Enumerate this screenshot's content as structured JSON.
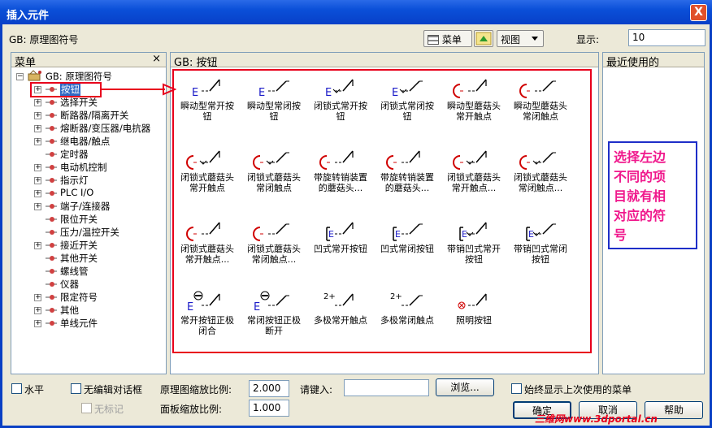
{
  "window": {
    "title": "插入元件",
    "close_label": "X"
  },
  "toolbar": {
    "standard_label": "GB: 原理图符号",
    "menu_btn": "菜单",
    "view_btn": "视图",
    "display_label": "显示:",
    "display_value": "10"
  },
  "tree": {
    "header": "菜单",
    "close": "×",
    "root": "GB: 原理图符号",
    "items": [
      {
        "label": "按钮",
        "expandable": true,
        "selected": true
      },
      {
        "label": "选择开关",
        "expandable": true
      },
      {
        "label": "断路器/隔离开关",
        "expandable": true
      },
      {
        "label": "熔断器/变压器/电抗器",
        "expandable": true
      },
      {
        "label": "继电器/触点",
        "expandable": true
      },
      {
        "label": "定时器",
        "expandable": false
      },
      {
        "label": "电动机控制",
        "expandable": true
      },
      {
        "label": "指示灯",
        "expandable": true
      },
      {
        "label": "PLC I/O",
        "expandable": true
      },
      {
        "label": "端子/连接器",
        "expandable": true
      },
      {
        "label": "限位开关",
        "expandable": false
      },
      {
        "label": "压力/温控开关",
        "expandable": false
      },
      {
        "label": "接近开关",
        "expandable": true
      },
      {
        "label": "其他开关",
        "expandable": false
      },
      {
        "label": "螺线管",
        "expandable": false
      },
      {
        "label": "仪器",
        "expandable": false
      },
      {
        "label": "限定符号",
        "expandable": true
      },
      {
        "label": "其他",
        "expandable": true
      },
      {
        "label": "单线元件",
        "expandable": true
      }
    ]
  },
  "grid": {
    "header": "GB: 按钮",
    "items": [
      {
        "l1": "瞬动型常开按",
        "l2": "钮",
        "icon": "push-no-icon"
      },
      {
        "l1": "瞬动型常闭按",
        "l2": "钮",
        "icon": "push-nc-icon"
      },
      {
        "l1": "闭锁式常开按",
        "l2": "钮",
        "icon": "latch-no-icon"
      },
      {
        "l1": "闭锁式常闭按",
        "l2": "钮",
        "icon": "latch-nc-icon"
      },
      {
        "l1": "瞬动型蘑菇头",
        "l2": "常开触点",
        "icon": "mushroom-no-icon"
      },
      {
        "l1": "瞬动型蘑菇头",
        "l2": "常闭触点",
        "icon": "mushroom-nc-icon"
      },
      {
        "l1": "闭锁式蘑菇头",
        "l2": "常开触点",
        "icon": "latch-mushroom-no-icon"
      },
      {
        "l1": "闭锁式蘑菇头",
        "l2": "常闭触点",
        "icon": "latch-mushroom-nc-icon"
      },
      {
        "l1": "带旋转销装置",
        "l2": "的蘑菇头...",
        "icon": "rotary-mushroom-icon"
      },
      {
        "l1": "带旋转销装置",
        "l2": "的蘑菇头...",
        "icon": "rotary-mushroom2-icon"
      },
      {
        "l1": "闭锁式蘑菇头",
        "l2": "常开触点...",
        "icon": "latch-mushroom-no2-icon"
      },
      {
        "l1": "闭锁式蘑菇头",
        "l2": "常闭触点...",
        "icon": "latch-mushroom-nc2-icon"
      },
      {
        "l1": "闭锁式蘑菇头",
        "l2": "常开触点...",
        "icon": "key-mushroom-no-icon"
      },
      {
        "l1": "闭锁式蘑菇头",
        "l2": "常闭触点...",
        "icon": "key-mushroom-nc-icon"
      },
      {
        "l1": "凹式常开按钮",
        "l2": "",
        "icon": "recessed-no-icon"
      },
      {
        "l1": "凹式常闭按钮",
        "l2": "",
        "icon": "recessed-nc-icon"
      },
      {
        "l1": "带销凹式常开",
        "l2": "按钮",
        "icon": "pin-recessed-no-icon"
      },
      {
        "l1": "带销凹式常闭",
        "l2": "按钮",
        "icon": "pin-recessed-nc-icon"
      },
      {
        "l1": "常开按钮正极",
        "l2": "闭合",
        "icon": "positive-no-icon"
      },
      {
        "l1": "常闭按钮正极",
        "l2": "断开",
        "icon": "positive-nc-icon"
      },
      {
        "l1": "多极常开触点",
        "l2": "",
        "icon": "multipole-no-icon"
      },
      {
        "l1": "多极常闭触点",
        "l2": "",
        "icon": "multipole-nc-icon"
      },
      {
        "l1": "照明按钮",
        "l2": "",
        "icon": "illuminated-icon"
      }
    ]
  },
  "recent": {
    "header": "最近使用的",
    "note_lines": [
      "选择左边",
      "不同的项",
      "目就有相",
      "对应的符",
      "号"
    ]
  },
  "bottom": {
    "horizontal": "水平",
    "no_edit_dialog": "无编辑对话框",
    "no_tag": "无标记",
    "scale_label": "原理图缩放比例:",
    "scale_value": "2.000",
    "panel_scale_label": "面板缩放比例:",
    "panel_scale_value": "1.000",
    "type_label": "请键入:",
    "type_value": "",
    "browse": "浏览...",
    "always_show": "始终显示上次使用的菜单",
    "ok": "确定",
    "cancel": "取消",
    "help": "帮助",
    "watermark": "三维网www.3dportal.cn"
  },
  "colors": {
    "highlight_red": "#e8001c",
    "note_blue": "#1e2ec8",
    "note_text": "#f0188c",
    "symbol_blue": "#1a1ac8",
    "symbol_red": "#d00000"
  }
}
